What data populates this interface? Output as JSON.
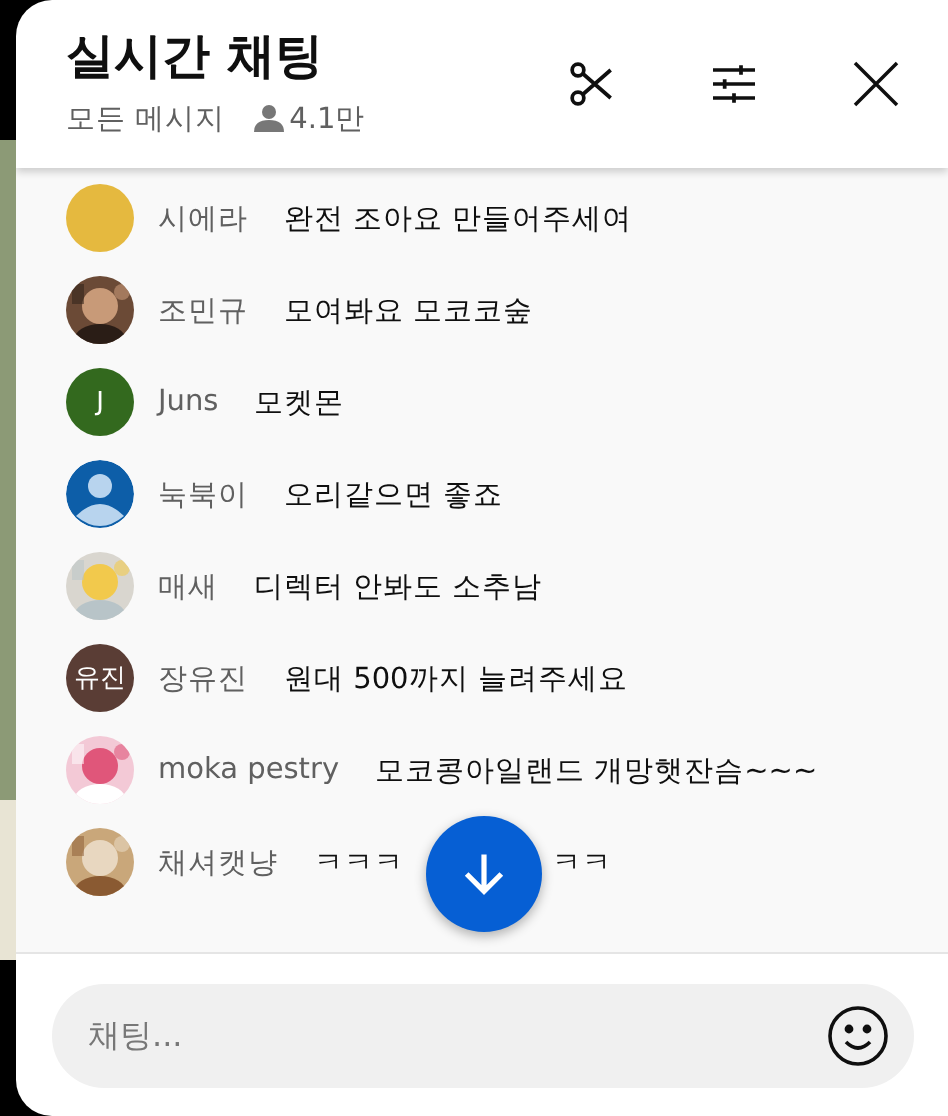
{
  "header": {
    "title": "실시간 채팅",
    "filter": "모든 메시지",
    "viewers": "4.1만"
  },
  "messages": [
    {
      "author": "시에라",
      "text": [
        "완전 조아요 만들어주세여"
      ],
      "avatar": {
        "kind": "plain",
        "color": "#e5b93f"
      }
    },
    {
      "author": "조민규",
      "text": [
        "모여봐요 모코코숲"
      ],
      "avatar": {
        "kind": "picture"
      }
    },
    {
      "author": "Juns",
      "text": [
        "모켓몬"
      ],
      "avatar": {
        "kind": "letter",
        "label": "J",
        "color": "#33691e"
      }
    },
    {
      "author": "눅북이",
      "text": [
        "오리같으면 좋죠"
      ],
      "avatar": {
        "kind": "person",
        "color": "#0d5ea8"
      }
    },
    {
      "author": "매새",
      "text": [
        "디렉터 안봐도 소추남"
      ],
      "avatar": {
        "kind": "picture"
      }
    },
    {
      "author": "장유진",
      "text": [
        "원대 500까지 늘려주세요"
      ],
      "avatar": {
        "kind": "letter",
        "label": "유진",
        "color": "#5a3d35"
      }
    },
    {
      "author": "moka pestry",
      "text": [
        "모코콩아일랜드 개망햇잔슴~~~"
      ],
      "avatar": {
        "kind": "picture"
      }
    },
    {
      "author": "채셔캣냥",
      "text": [
        "ㅋㅋㅋ",
        "ㅋㅋ"
      ],
      "avatar": {
        "kind": "picture"
      }
    }
  ],
  "input": {
    "placeholder": "채팅..."
  }
}
